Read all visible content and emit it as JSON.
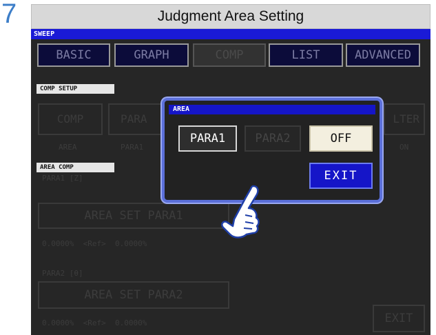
{
  "step_number": "7",
  "header_title": "Judgment Area Setting",
  "sweep_label": "SWEEP",
  "tabs": [
    "BASIC",
    "GRAPH",
    "COMP",
    "LIST",
    "ADVANCED"
  ],
  "comp_setup": {
    "section_label": "COMP SETUP",
    "buttons": [
      "COMP",
      "PARA",
      "LTER"
    ],
    "values": [
      "AREA",
      "PARA1",
      "ON"
    ]
  },
  "area_comp": {
    "section_label": "AREA COMP",
    "para1_label": "PARA1 [Z]",
    "para1_button": "AREA SET PARA1",
    "para1_values": "0.0000%  <Ref>  0.0000%",
    "para2_label": "PARA2 [θ]",
    "para2_button": "AREA SET PARA2",
    "para2_values": "0.0000%  <Ref>  0.0000%"
  },
  "exit_label": "EXIT",
  "dialog": {
    "title": "AREA",
    "para1": "PARA1",
    "para2": "PARA2",
    "off": "OFF",
    "exit": "EXIT"
  },
  "colors": {
    "accent_blue": "#1515c8",
    "dialog_border": "#5b6fd9",
    "step_number": "#3d7ec8"
  },
  "icons": [
    "pointing-hand-icon"
  ]
}
